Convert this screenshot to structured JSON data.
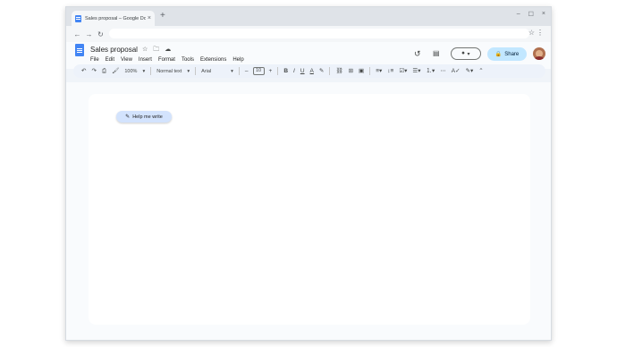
{
  "browser": {
    "tab_title": "Sales proposal – Google Docs",
    "new_tab": "+",
    "close_tab": "×",
    "controls": {
      "minimize": "–",
      "maximize": "☐",
      "close": "×"
    },
    "nav": {
      "back": "←",
      "forward": "→",
      "reload": "↻",
      "star": "☆",
      "menu": "⋮"
    }
  },
  "header": {
    "title": "Sales proposal",
    "title_icons": {
      "star": "☆",
      "folder": "🗀",
      "cloud": "☁"
    },
    "menu": [
      "File",
      "Edit",
      "View",
      "Insert",
      "Format",
      "Tools",
      "Extensions",
      "Help"
    ],
    "history_icon": "↺",
    "comment_icon": "▤",
    "meet": {
      "camera": "⏺",
      "caret": "▾"
    },
    "share": {
      "lock": "🔒",
      "label": "Share"
    }
  },
  "format_bar": {
    "undo": "↶",
    "redo": "↷",
    "print": "⎙",
    "paint": "🖌",
    "zoom": "100%",
    "style": "Normal text",
    "font": "Arial",
    "size_minus": "–",
    "font_size": "10",
    "size_plus": "+",
    "bold": "B",
    "italic": "I",
    "underline": "U",
    "text_color": "A",
    "highlight": "✎",
    "link": "⛓",
    "comment": "⊞",
    "image": "▣",
    "align": "≡▾",
    "spacing": "↕≡",
    "checklist": "☑▾",
    "bullets": "☰▾",
    "numbered": "⒈▾",
    "more": "⋯",
    "spellcheck": "A✓",
    "editing": "✎▾",
    "collapse": "⌃",
    "caret": "▾"
  },
  "document": {
    "help_chip": {
      "icon": "✎",
      "label": "Help me write"
    }
  }
}
